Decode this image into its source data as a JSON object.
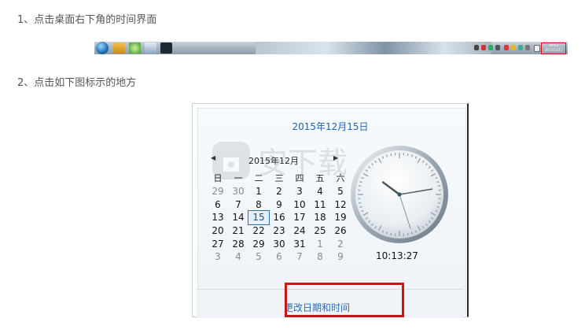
{
  "steps": {
    "step1": "1、点击桌面右下角的时间界面",
    "step2": "2、点击如下图标示的地方"
  },
  "taskbar": {
    "clock_time": "10:13",
    "clock_date": "2015/12/15",
    "highlight_color": "#d01818"
  },
  "popup": {
    "big_date": "2015年12月15日",
    "month_label": "2015年12月",
    "weekdays": [
      "日",
      "一",
      "二",
      "三",
      "四",
      "五",
      "六"
    ],
    "weeks": [
      [
        "29",
        "30",
        "1",
        "2",
        "3",
        "4",
        "5"
      ],
      [
        "6",
        "7",
        "8",
        "9",
        "10",
        "11",
        "12"
      ],
      [
        "13",
        "14",
        "15",
        "16",
        "17",
        "18",
        "19"
      ],
      [
        "20",
        "21",
        "22",
        "23",
        "24",
        "25",
        "26"
      ],
      [
        "27",
        "28",
        "29",
        "30",
        "31",
        "1",
        "2"
      ],
      [
        "3",
        "4",
        "5",
        "6",
        "7",
        "8",
        "9"
      ]
    ],
    "today": "15",
    "digital_time": "10:13:27",
    "change_link": "更改日期和时间",
    "highlight_color": "#c8141b"
  },
  "watermark": {
    "text": "安下载"
  }
}
